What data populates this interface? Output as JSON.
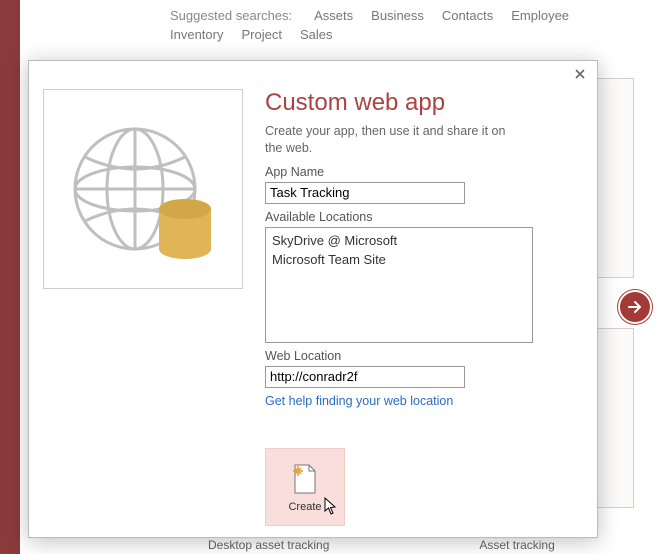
{
  "backstage": {
    "suggested_label": "Suggested searches:",
    "suggested": [
      "Assets",
      "Business",
      "Contacts",
      "Employee",
      "Inventory",
      "Project",
      "Sales"
    ],
    "template1": "Desktop asset tracking",
    "template2": "Asset tracking"
  },
  "dialog": {
    "title": "Custom web app",
    "desc": "Create your app, then use it and share it on the web.",
    "app_name_label": "App Name",
    "app_name_value": "Task Tracking",
    "locations_label": "Available Locations",
    "locations": [
      "SkyDrive @ Microsoft",
      "Microsoft Team Site"
    ],
    "web_location_label": "Web Location",
    "web_location_value": "http://conradr2f",
    "help_link": "Get help finding your web location",
    "create_label": "Create"
  }
}
